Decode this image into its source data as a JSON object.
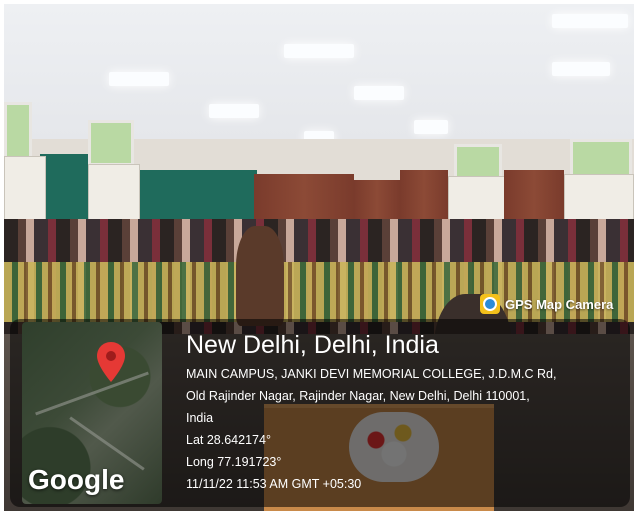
{
  "camera_app": {
    "name": "GPS Map Camera",
    "icon": "gps-map-camera-icon"
  },
  "map": {
    "brand": "Google",
    "pin_icon": "map-pin-icon",
    "pin_color": "#e53935"
  },
  "location": {
    "title": "New Delhi, Delhi, India",
    "address_line1": "MAIN CAMPUS, JANKI DEVI MEMORIAL COLLEGE, J.D.M.C Rd,",
    "address_line2": "Old Rajinder Nagar, Rajinder Nagar, New Delhi, Delhi 110001,",
    "address_line3": "India",
    "lat": "Lat 28.642174°",
    "long": "Long 77.191723°",
    "timestamp": "11/11/22 11:53 AM GMT +05:30"
  }
}
